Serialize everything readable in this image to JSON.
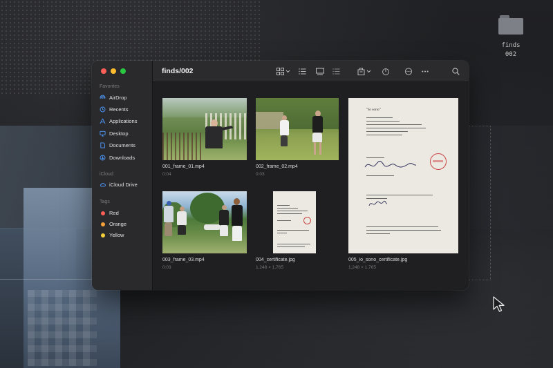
{
  "desktop": {
    "folder_label": "finds\n002"
  },
  "window": {
    "title": "finds/002",
    "traffic_lights": {
      "close": "#fe5f57",
      "minimize": "#febc2e",
      "zoom": "#28c840"
    }
  },
  "sidebar": {
    "favorites_header": "Favorites",
    "favorites": [
      {
        "label": "AirDrop",
        "icon": "airdrop-icon"
      },
      {
        "label": "Recents",
        "icon": "clock-icon"
      },
      {
        "label": "Applications",
        "icon": "applications-icon"
      },
      {
        "label": "Desktop",
        "icon": "desktop-icon"
      },
      {
        "label": "Documents",
        "icon": "document-icon"
      },
      {
        "label": "Downloads",
        "icon": "download-icon"
      }
    ],
    "icloud_header": "iCloud",
    "icloud": [
      {
        "label": "iCloud Drive",
        "icon": "cloud-icon"
      }
    ],
    "tags_header": "Tags",
    "tags": [
      {
        "label": "Red",
        "color": "#ff5f57"
      },
      {
        "label": "Orange",
        "color": "#f6a23a"
      },
      {
        "label": "Yellow",
        "color": "#f5d03b"
      }
    ]
  },
  "toolbar": {
    "icons": [
      "grid-view-icon",
      "list-view-icon",
      "gallery-view-icon",
      "column-view-icon",
      "group-icon",
      "share-icon",
      "tag-icon",
      "more-icon",
      "search-icon"
    ]
  },
  "files": [
    {
      "name": "001_frame_01.mp4",
      "meta": "0:04"
    },
    {
      "name": "002_frame_02.mp4",
      "meta": "0:03"
    },
    {
      "name": "005_io_sono_certificate.jpg",
      "meta": "1,248 × 1,765"
    },
    {
      "name": "003_frame_03.mp4",
      "meta": "0:03"
    },
    {
      "name": "004_certificate.jpg",
      "meta": "1,248 × 1,765"
    }
  ],
  "document_preview": {
    "heading": "\"Io sono\""
  }
}
